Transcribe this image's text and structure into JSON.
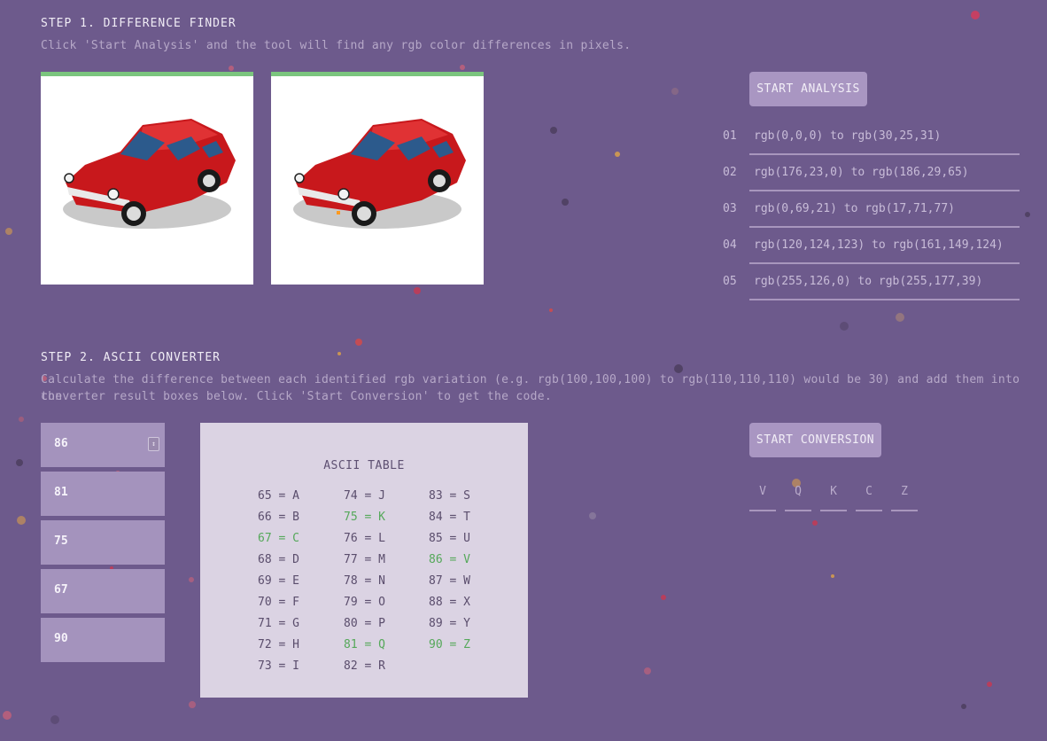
{
  "step1": {
    "title": "STEP 1. DIFFERENCE FINDER",
    "description": "Click 'Start Analysis' and the tool will find any rgb color differences in pixels.",
    "button_label": "START ANALYSIS",
    "results": [
      {
        "num": "01",
        "text": "rgb(0,0,0) to rgb(30,25,31)"
      },
      {
        "num": "02",
        "text": "rgb(176,23,0) to rgb(186,29,65)"
      },
      {
        "num": "03",
        "text": "rgb(0,69,21) to rgb(17,71,77)"
      },
      {
        "num": "04",
        "text": "rgb(120,124,123) to rgb(161,149,124)"
      },
      {
        "num": "05",
        "text": "rgb(255,126,0) to rgb(255,177,39)"
      }
    ]
  },
  "step2": {
    "title": "STEP 2. ASCII CONVERTER",
    "description_line1": "Calculate the difference between each identified rgb variation (e.g. rgb(100,100,100) to rgb(110,110,110) would be 30) and add them into the",
    "description_line2": "converter result boxes below. Click 'Start Conversion' to get the code.",
    "converter_values": [
      "86",
      "81",
      "75",
      "67",
      "90"
    ],
    "button_label": "START CONVERSION",
    "output_letters": [
      "V",
      "Q",
      "K",
      "C",
      "Z"
    ],
    "ascii_table_title": "ASCII TABLE",
    "ascii_table": [
      {
        "text": "65 = A",
        "highlight": false
      },
      {
        "text": "66 = B",
        "highlight": false
      },
      {
        "text": "67 = C",
        "highlight": true
      },
      {
        "text": "68 = D",
        "highlight": false
      },
      {
        "text": "69 = E",
        "highlight": false
      },
      {
        "text": "70 = F",
        "highlight": false
      },
      {
        "text": "71 = G",
        "highlight": false
      },
      {
        "text": "72 = H",
        "highlight": false
      },
      {
        "text": "73 = I",
        "highlight": false
      },
      {
        "text": "74 = J",
        "highlight": false
      },
      {
        "text": "75 = K",
        "highlight": true
      },
      {
        "text": "76 = L",
        "highlight": false
      },
      {
        "text": "77 = M",
        "highlight": false
      },
      {
        "text": "78 = N",
        "highlight": false
      },
      {
        "text": "79 = O",
        "highlight": false
      },
      {
        "text": "80 = P",
        "highlight": false
      },
      {
        "text": "81 = Q",
        "highlight": true
      },
      {
        "text": "82 = R",
        "highlight": false
      },
      {
        "text": "83 = S",
        "highlight": false
      },
      {
        "text": "84 = T",
        "highlight": false
      },
      {
        "text": "85 = U",
        "highlight": false
      },
      {
        "text": "86 = V",
        "highlight": true
      },
      {
        "text": "87 = W",
        "highlight": false
      },
      {
        "text": "88 = X",
        "highlight": false
      },
      {
        "text": "89 = Y",
        "highlight": false
      },
      {
        "text": "90 = Z",
        "highlight": true
      }
    ]
  },
  "colors": {
    "background": "#6d5a8c",
    "accent_green": "#7bc57e",
    "button": "#a996c2",
    "highlight_text": "#55a85a"
  },
  "icons": {
    "stepper": "number-stepper-icon",
    "car": "red-pixel-car-image"
  }
}
